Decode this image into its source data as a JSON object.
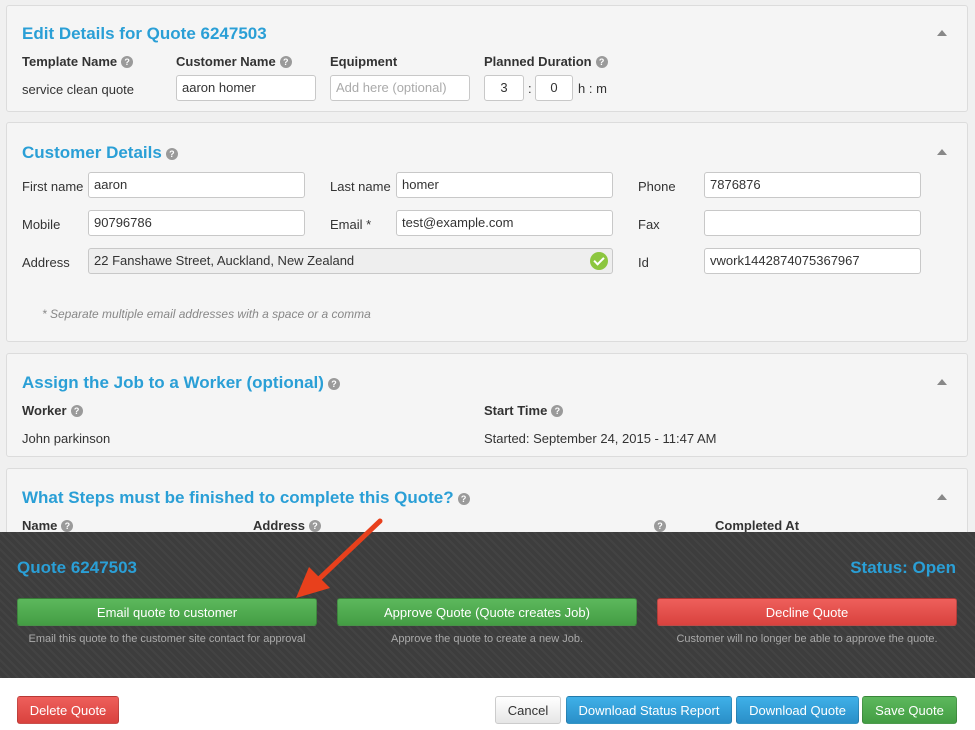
{
  "quote_details": {
    "title": "Edit Details for Quote 6247503",
    "template_name_label": "Template Name",
    "template_name_value": "service clean quote",
    "customer_name_label": "Customer Name",
    "customer_name_value": "aaron homer",
    "equipment_label": "Equipment",
    "equipment_placeholder": "Add here (optional)",
    "planned_duration_label": "Planned Duration",
    "duration_hours": "3",
    "duration_minutes": "0",
    "duration_sep": ":",
    "duration_unit": "h : m"
  },
  "customer_details": {
    "title": "Customer Details",
    "first_name_label": "First name",
    "first_name_value": "aaron",
    "last_name_label": "Last name",
    "last_name_value": "homer",
    "phone_label": "Phone",
    "phone_value": "7876876",
    "mobile_label": "Mobile",
    "mobile_value": "90796786",
    "email_label": "Email *",
    "email_value": "test@example.com",
    "fax_label": "Fax",
    "fax_value": "",
    "address_label": "Address",
    "address_value": "22 Fanshawe Street, Auckland, New Zealand",
    "id_label": "Id",
    "id_value": "vwork1442874075367967",
    "note": "* Separate multiple email addresses with a space or a comma"
  },
  "assign_worker": {
    "title": "Assign the Job to a Worker (optional)",
    "worker_label": "Worker",
    "worker_value": "John parkinson",
    "start_time_label": "Start Time",
    "start_time_value": "Started: September 24, 2015 - 11:47 AM"
  },
  "steps": {
    "title": "What Steps must be finished to complete this Quote?",
    "col_name": "Name",
    "col_address": "Address",
    "col_completed": "Completed At"
  },
  "action_bar": {
    "quote_title": "Quote 6247503",
    "status": "Status: Open",
    "email_btn": "Email quote to customer",
    "email_desc": "Email this quote to the customer site contact for approval",
    "approve_btn": "Approve Quote (Quote creates Job)",
    "approve_desc": "Approve the quote to create a new Job.",
    "decline_btn": "Decline Quote",
    "decline_desc": "Customer will no longer be able to approve the quote."
  },
  "footer": {
    "delete": "Delete Quote",
    "cancel": "Cancel",
    "download_status": "Download Status Report",
    "download_quote": "Download Quote",
    "save": "Save Quote"
  },
  "help_glyph": "?",
  "colors": {
    "accent": "#2a9fd6",
    "green": "#5cb85c",
    "red": "#d9534f",
    "blue": "#2a9fd6",
    "dark_bar": "#3d3d3d",
    "arrow": "#e8401c"
  }
}
